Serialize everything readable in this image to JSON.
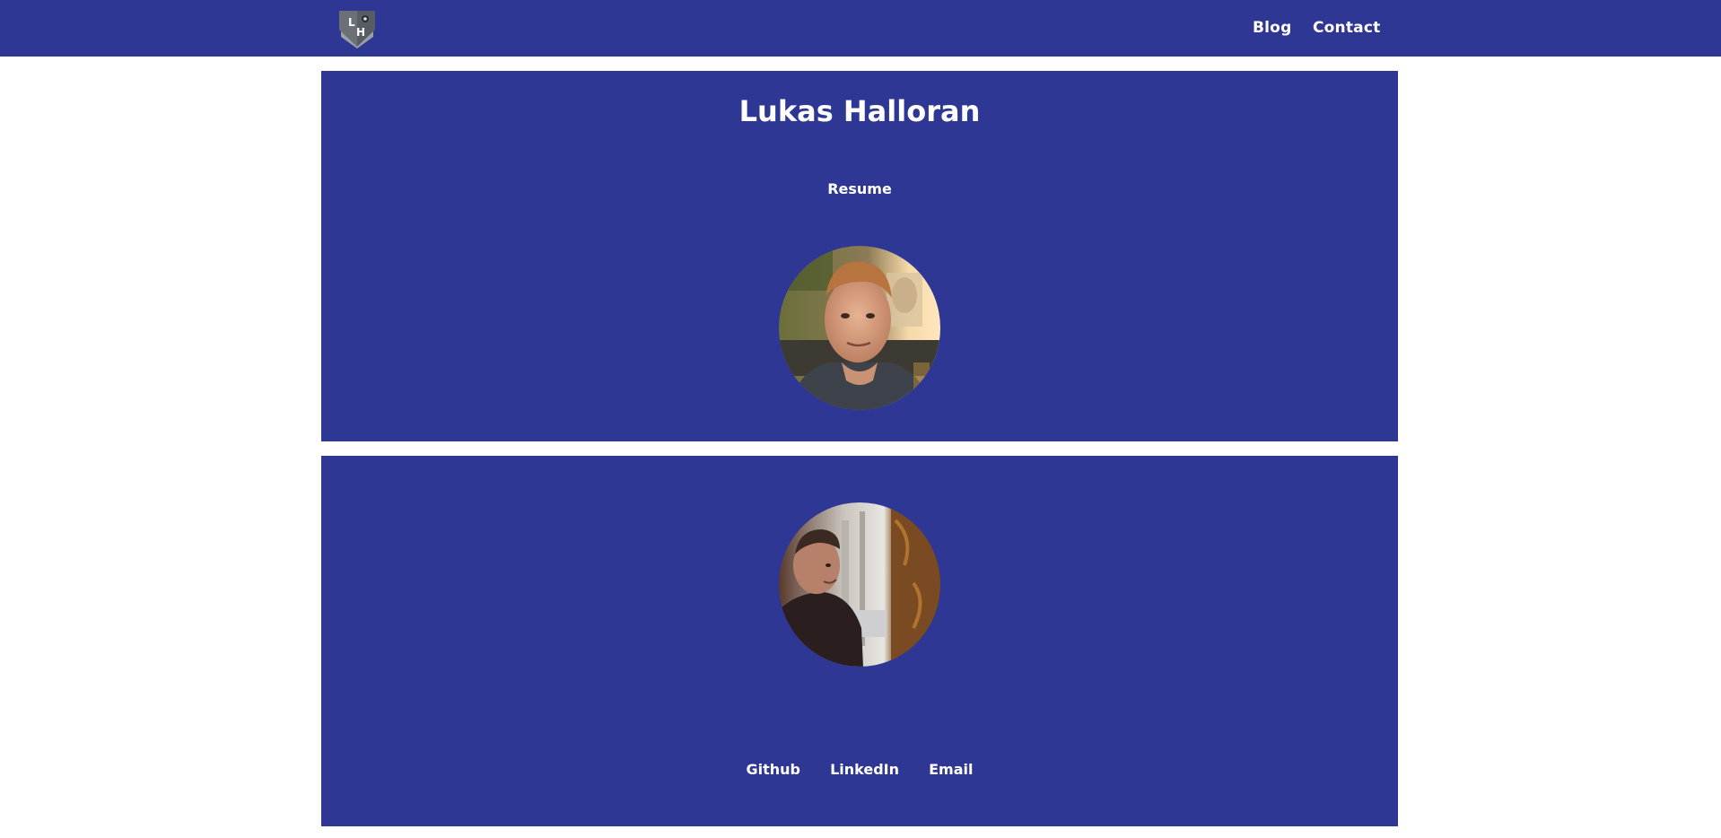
{
  "nav": {
    "logo_icon": "lh-shield-logo",
    "links": {
      "blog": "Blog",
      "contact": "Contact"
    }
  },
  "hero": {
    "name": "Lukas Halloran",
    "resume_label": "Resume",
    "photo": "portrait-photo"
  },
  "about": {
    "photo": "side-profile-photo",
    "social": {
      "github": "Github",
      "linkedin": "LinkedIn",
      "email": "Email"
    }
  },
  "colors": {
    "brand": "#2e3794",
    "text": "#ffffff",
    "background": "#ffffff"
  }
}
